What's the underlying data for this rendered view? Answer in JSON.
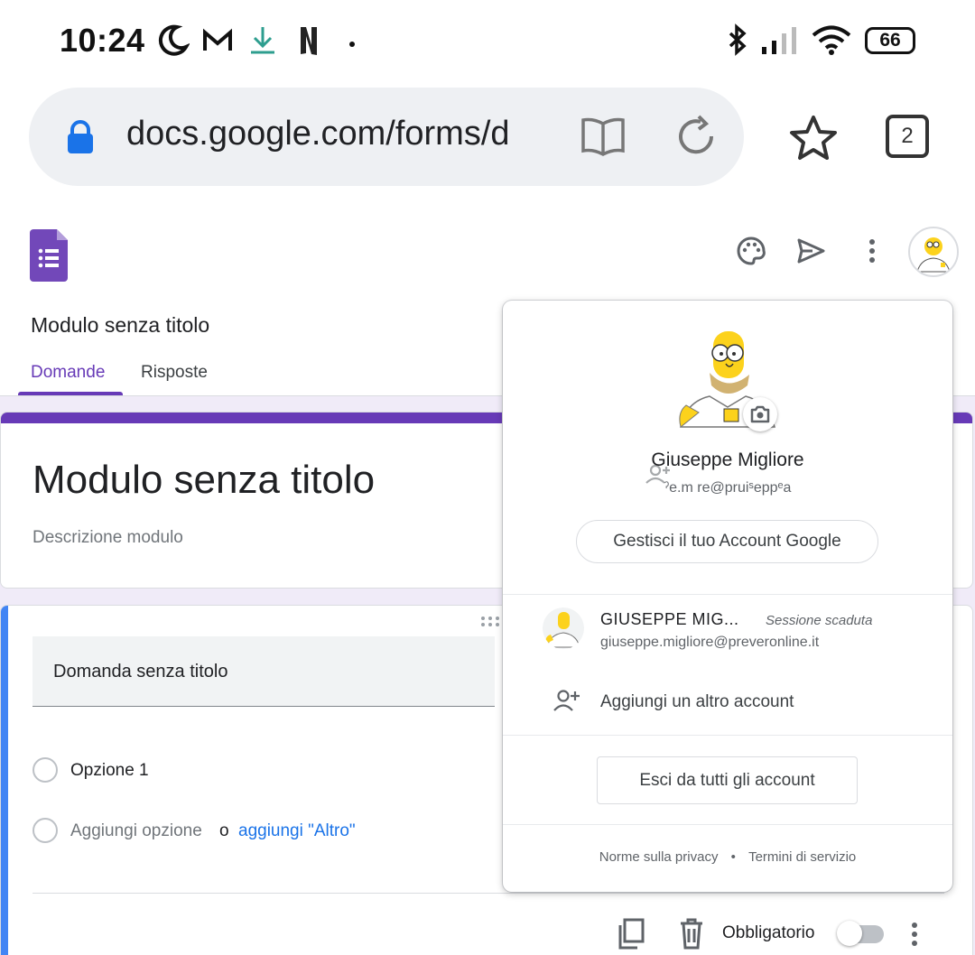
{
  "status_bar": {
    "time": "10:24",
    "battery": "66",
    "icons": [
      "moon-icon",
      "gmail-icon",
      "download-icon",
      "netflix-icon",
      "dot-icon",
      "bluetooth-icon",
      "signal-icon",
      "wifi-icon",
      "battery-icon"
    ]
  },
  "browser": {
    "url": "docs.google.com/forms/d",
    "tab_count": "2"
  },
  "forms_header": {
    "doc_title": "Modulo senza titolo",
    "tabs": [
      {
        "label": "Domande",
        "active": true
      },
      {
        "label": "Risposte",
        "active": false
      }
    ],
    "accent_color": "#673ab7"
  },
  "form": {
    "title": "Modulo senza titolo",
    "description_placeholder": "Descrizione modulo",
    "question": {
      "title": "Domanda senza titolo",
      "option_1": "Opzione 1",
      "add_option": "Aggiungi opzione",
      "or": "o",
      "add_other": "aggiungi \"Altro\"",
      "required_label": "Obbligatorio"
    }
  },
  "account_popup": {
    "name": "Giuseppe Migliore",
    "email": "ˀe.m re@pruiˢeppᵉa",
    "manage_button": "Gestisci il tuo Account Google",
    "other_account": {
      "name": "GIUSEPPE MIG...",
      "status": "Sessione scaduta",
      "email": "giuseppe.migliore@preveronline.it"
    },
    "add_account": "Aggiungi un altro account",
    "sign_out": "Esci da tutti gli account",
    "privacy": "Norme sulla privacy",
    "separator": "•",
    "terms": "Termini di servizio"
  }
}
